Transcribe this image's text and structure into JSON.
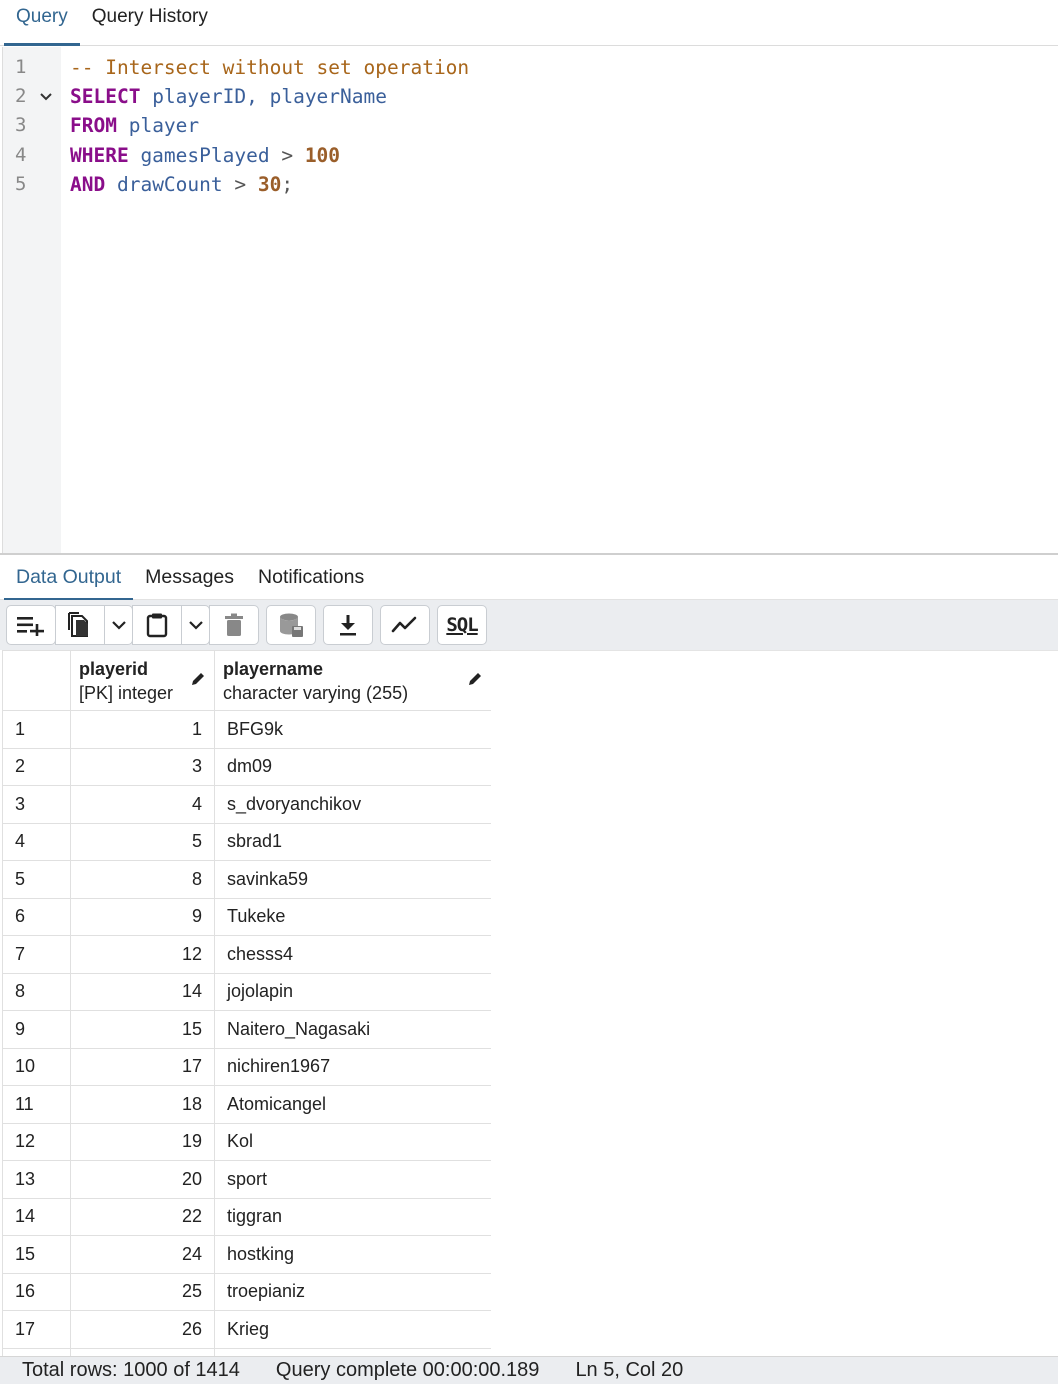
{
  "query_tabs": [
    {
      "label": "Query",
      "active": true
    },
    {
      "label": "Query History",
      "active": false
    }
  ],
  "editor": {
    "lines": [
      {
        "n": "1",
        "tokens": [
          {
            "t": "-- Intersect without set operation",
            "c": "cm"
          }
        ]
      },
      {
        "n": "2",
        "fold": true,
        "tokens": [
          {
            "t": "SELECT",
            "c": "kw"
          },
          {
            "t": " playerID, playerName",
            "c": "id"
          }
        ]
      },
      {
        "n": "3",
        "tokens": [
          {
            "t": "FROM",
            "c": "kw"
          },
          {
            "t": " player",
            "c": "id"
          }
        ]
      },
      {
        "n": "4",
        "tokens": [
          {
            "t": "WHERE",
            "c": "kw"
          },
          {
            "t": " gamesPlayed ",
            "c": "id"
          },
          {
            "t": ">",
            "c": "op"
          },
          {
            "t": " 100",
            "c": "num"
          }
        ]
      },
      {
        "n": "5",
        "tokens": [
          {
            "t": "AND",
            "c": "kw"
          },
          {
            "t": " drawCount ",
            "c": "id"
          },
          {
            "t": ">",
            "c": "op"
          },
          {
            "t": " 30",
            "c": "num"
          },
          {
            "t": ";",
            "c": "op"
          }
        ]
      }
    ]
  },
  "output_tabs": [
    {
      "label": "Data Output",
      "active": true
    },
    {
      "label": "Messages",
      "active": false
    },
    {
      "label": "Notifications",
      "active": false
    }
  ],
  "toolbar": {
    "icons": [
      "add-row-icon",
      "copy-icon",
      "chevron-down-icon",
      "paste-icon",
      "chevron-down-icon",
      "delete-icon",
      "save-data-icon",
      "download-icon",
      "graph-icon",
      "sql-icon"
    ],
    "sql_label": "SQL"
  },
  "grid": {
    "columns": [
      {
        "name": "playerid",
        "type": "[PK] integer"
      },
      {
        "name": "playername",
        "type": "character varying (255)"
      }
    ],
    "rows": [
      [
        "1",
        "1",
        "BFG9k"
      ],
      [
        "2",
        "3",
        "dm09"
      ],
      [
        "3",
        "4",
        "s_dvoryanchikov"
      ],
      [
        "4",
        "5",
        "sbrad1"
      ],
      [
        "5",
        "8",
        "savinka59"
      ],
      [
        "6",
        "9",
        "Tukeke"
      ],
      [
        "7",
        "12",
        "chesss4"
      ],
      [
        "8",
        "14",
        "jojolapin"
      ],
      [
        "9",
        "15",
        "Naitero_Nagasaki"
      ],
      [
        "10",
        "17",
        "nichiren1967"
      ],
      [
        "11",
        "18",
        "Atomicangel"
      ],
      [
        "12",
        "19",
        "Kol"
      ],
      [
        "13",
        "20",
        "sport"
      ],
      [
        "14",
        "22",
        "tiggran"
      ],
      [
        "15",
        "24",
        "hostking"
      ],
      [
        "16",
        "25",
        "troepianiz"
      ],
      [
        "17",
        "26",
        "Krieg"
      ],
      [
        "",
        "",
        ""
      ]
    ]
  },
  "status": {
    "total_rows": "Total rows: 1000 of 1414",
    "query_complete": "Query complete 00:00:00.189",
    "cursor": "Ln 5, Col 20"
  },
  "colors": {
    "accent": "#326690",
    "keyword": "#8a0e8a",
    "identifier": "#3a5f9a",
    "comment": "#a8661b",
    "number": "#9a5e2a"
  }
}
